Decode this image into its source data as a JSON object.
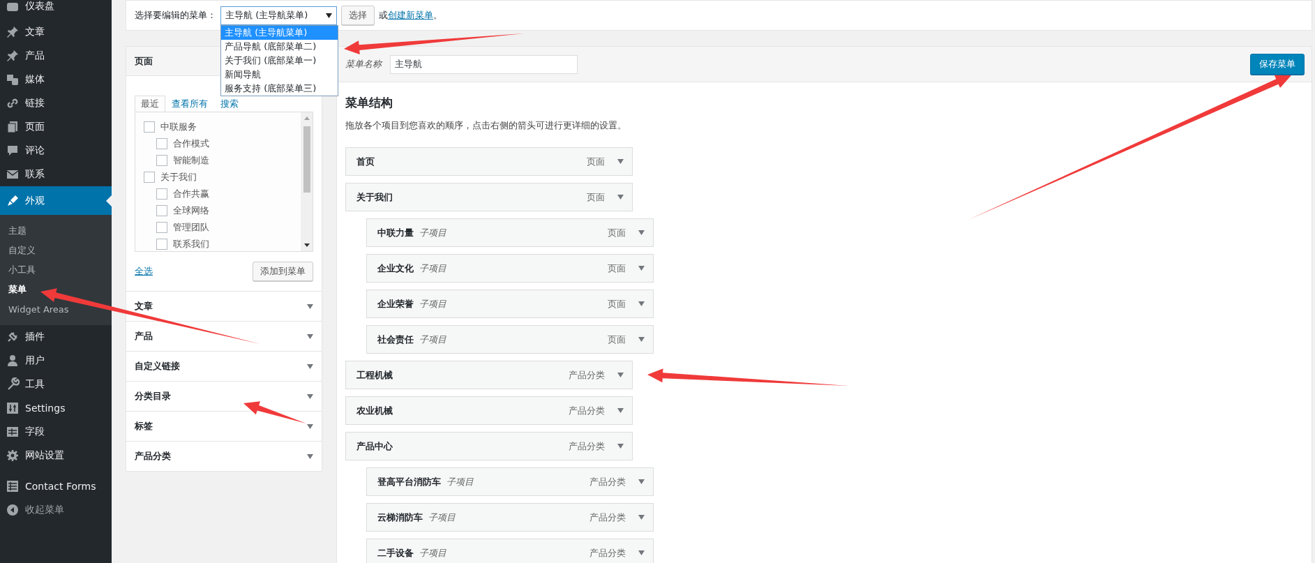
{
  "sidebar": {
    "groups": [
      [
        {
          "label": "仪表盘",
          "selected": false
        }
      ],
      [
        {
          "label": "文章",
          "selected": false
        },
        {
          "label": "产品",
          "selected": false
        },
        {
          "label": "媒体",
          "selected": false
        },
        {
          "label": "链接",
          "selected": false
        },
        {
          "label": "页面",
          "selected": false
        },
        {
          "label": "评论",
          "selected": false
        },
        {
          "label": "联系",
          "selected": false
        },
        {
          "label": "外观",
          "selected": true,
          "children": [
            {
              "label": "主题",
              "selected": false
            },
            {
              "label": "自定义",
              "selected": false
            },
            {
              "label": "小工具",
              "selected": false
            },
            {
              "label": "菜单",
              "selected": true
            },
            {
              "label": "Widget Areas",
              "selected": false
            }
          ]
        },
        {
          "label": "插件",
          "selected": false
        },
        {
          "label": "用户",
          "selected": false
        },
        {
          "label": "工具",
          "selected": false
        },
        {
          "label": "Settings",
          "selected": false
        },
        {
          "label": "字段",
          "selected": false
        },
        {
          "label": "网站设置",
          "selected": false
        }
      ],
      [
        {
          "label": "Contact Forms",
          "selected": false
        }
      ]
    ],
    "collapse": "收起菜单"
  },
  "menu_select": {
    "label": "选择要编辑的菜单：",
    "value": "主导航 (主导航菜单)",
    "expanded": true,
    "options": [
      {
        "label": "主导航 (主导航菜单)",
        "selected": true
      },
      {
        "label": "产品导航 (底部菜单二)",
        "selected": false
      },
      {
        "label": "关于我们 (底部菜单一)",
        "selected": false
      },
      {
        "label": "新闻导航",
        "selected": false
      },
      {
        "label": "服务支持 (底部菜单三)",
        "selected": false
      }
    ],
    "button": "选择",
    "or_text": "或",
    "create_link": "创建新菜单",
    "end_mark": "。"
  },
  "pages_box": {
    "title": "页面",
    "tabs": [
      {
        "label": "最近",
        "selected": true
      },
      {
        "label": "查看所有",
        "selected": false
      },
      {
        "label": "搜索",
        "selected": false
      }
    ],
    "items": [
      {
        "label": "中联服务",
        "checked": false,
        "children": [
          {
            "label": "合作模式",
            "checked": false
          },
          {
            "label": "智能制造",
            "checked": false
          }
        ]
      },
      {
        "label": "关于我们",
        "checked": false,
        "children": [
          {
            "label": "合作共赢",
            "checked": false
          },
          {
            "label": "全球网络",
            "checked": false
          },
          {
            "label": "管理团队",
            "checked": false
          },
          {
            "label": "联系我们",
            "checked": false
          }
        ]
      }
    ],
    "select_all": "全选",
    "add_button": "添加到菜单"
  },
  "sections": [
    {
      "title": "文章"
    },
    {
      "title": "产品"
    },
    {
      "title": "自定义链接"
    },
    {
      "title": "分类目录"
    },
    {
      "title": "标签"
    },
    {
      "title": "产品分类"
    }
  ],
  "menu_editor": {
    "name_label": "菜单名称",
    "name_value": "主导航",
    "save_button": "保存菜单",
    "structure_title": "菜单结构",
    "structure_hint": "拖放各个项目到您喜欢的顺序，点击右侧的箭头可进行更详细的设置。",
    "items": [
      {
        "title": "首页",
        "type": "页面"
      },
      {
        "title": "关于我们",
        "type": "页面",
        "children": [
          {
            "title": "中联力量",
            "note": "子项目",
            "type": "页面"
          },
          {
            "title": "企业文化",
            "note": "子项目",
            "type": "页面"
          },
          {
            "title": "企业荣誉",
            "note": "子项目",
            "type": "页面"
          },
          {
            "title": "社会责任",
            "note": "子项目",
            "type": "页面"
          }
        ]
      },
      {
        "title": "工程机械",
        "type": "产品分类"
      },
      {
        "title": "农业机械",
        "type": "产品分类"
      },
      {
        "title": "产品中心",
        "type": "产品分类",
        "children": [
          {
            "title": "登高平台消防车",
            "note": "子项目",
            "type": "产品分类"
          },
          {
            "title": "云梯消防车",
            "note": "子项目",
            "type": "产品分类"
          },
          {
            "title": "二手设备",
            "note": "子项目",
            "type": "产品分类"
          }
        ]
      }
    ]
  }
}
